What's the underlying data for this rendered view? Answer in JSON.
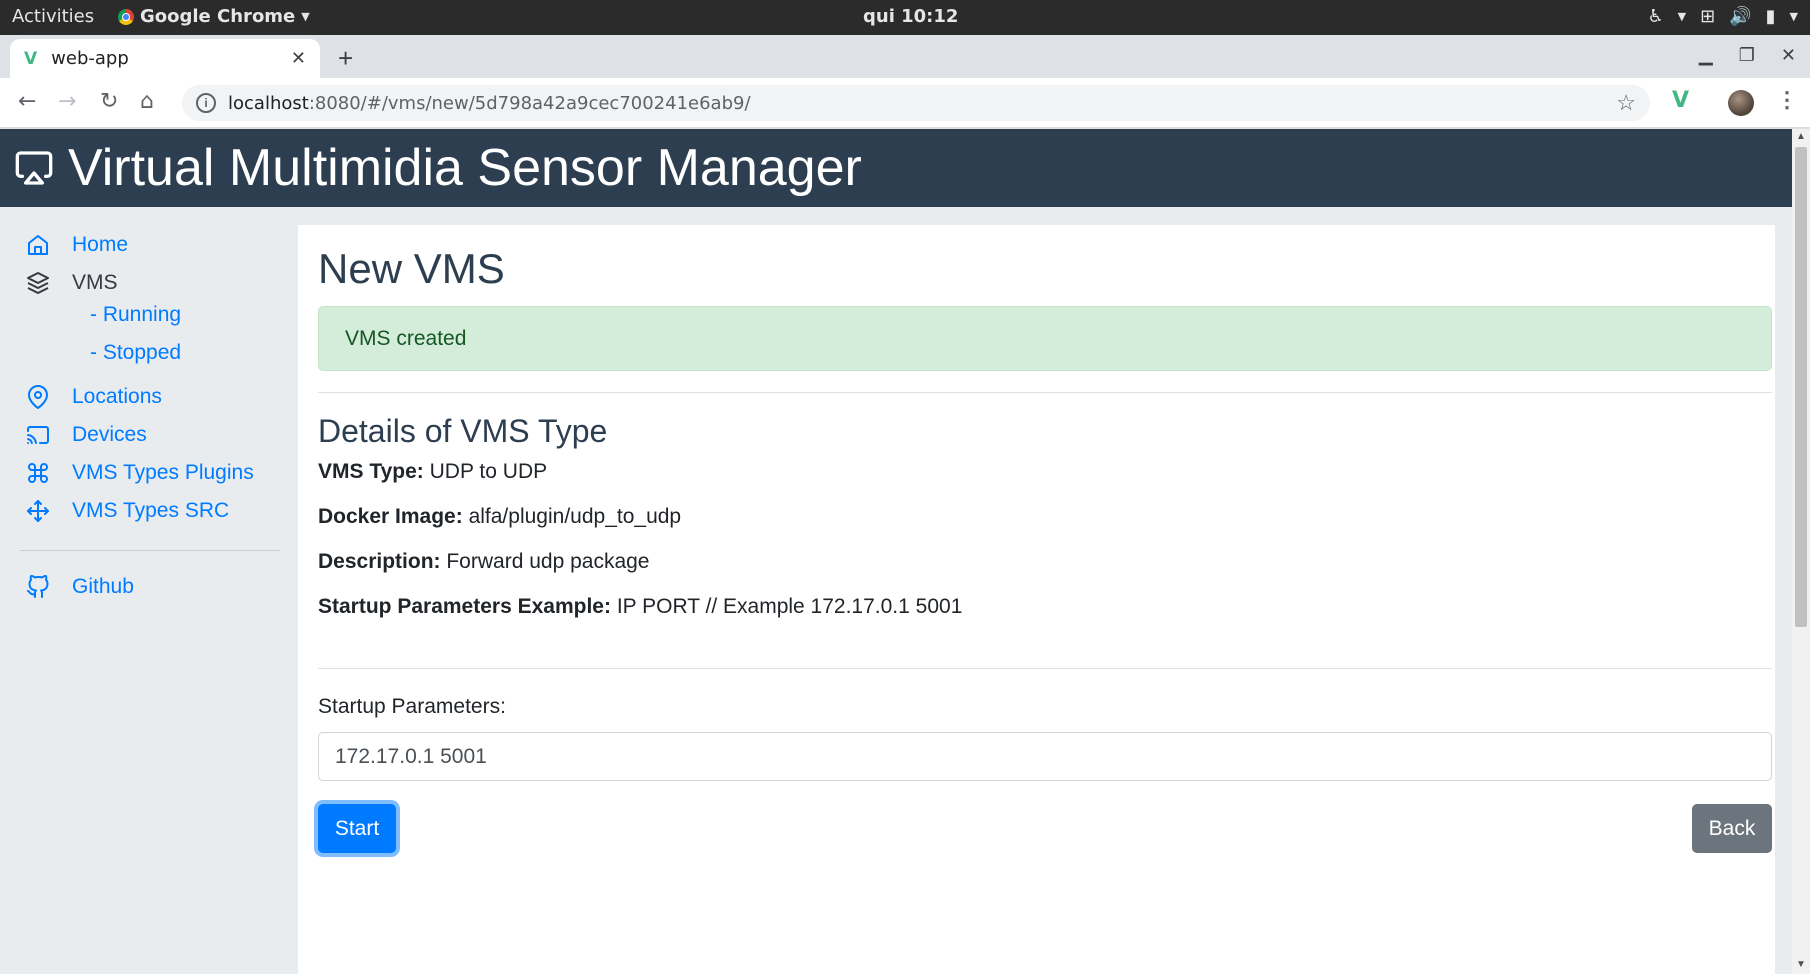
{
  "system": {
    "activities": "Activities",
    "app_name": "Google Chrome",
    "clock": "qui 10:12"
  },
  "browser": {
    "tab_title": "web-app",
    "url_host": "localhost",
    "url_rest": ":8080/#/vms/new/5d798a42a9cec700241e6ab9/"
  },
  "app": {
    "title": "Virtual Multimidia Sensor Manager"
  },
  "sidebar": {
    "home": "Home",
    "vms": "VMS",
    "running": "- Running",
    "stopped": "- Stopped",
    "locations": "Locations",
    "devices": "Devices",
    "vms_types_plugins": "VMS Types Plugins",
    "vms_types_src": "VMS Types SRC",
    "github": "Github"
  },
  "main": {
    "heading": "New VMS",
    "alert": "VMS created",
    "details_heading": "Details of VMS Type",
    "vms_type_label": "VMS Type:",
    "vms_type_value": "UDP to UDP",
    "docker_image_label": "Docker Image:",
    "docker_image_value": "alfa/plugin/udp_to_udp",
    "description_label": "Description:",
    "description_value": "Forward udp package",
    "startup_example_label": "Startup Parameters Example:",
    "startup_example_value": "IP PORT // Example 172.17.0.1 5001",
    "startup_label": "Startup Parameters:",
    "startup_value": "172.17.0.1 5001",
    "start_button": "Start",
    "back_button": "Back"
  },
  "colors": {
    "header_bg": "#2c3e50",
    "link": "#007bff",
    "alert_bg": "#d4edda",
    "start_btn": "#007bff",
    "back_btn": "#6c757d"
  }
}
